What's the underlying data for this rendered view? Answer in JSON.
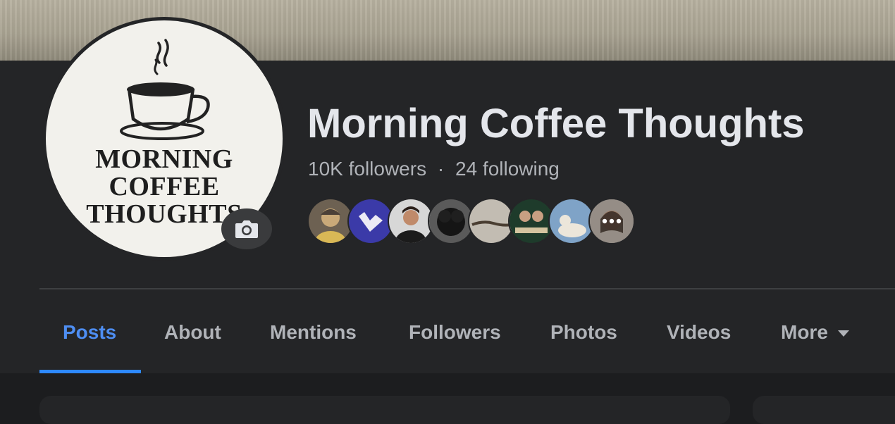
{
  "page": {
    "name": "Morning Coffee Thoughts",
    "logo_lines": [
      "MORNING",
      "COFFEE",
      "THOUGHTS"
    ],
    "followers": "10K followers",
    "separator": "·",
    "following": "24 following"
  },
  "follower_avatars": [
    {
      "name": "follower-avatar-1",
      "colors": [
        "#8a7a66",
        "#c9a979"
      ]
    },
    {
      "name": "follower-avatar-2",
      "colors": [
        "#3b3aa8",
        "#e8e8f0"
      ]
    },
    {
      "name": "follower-avatar-3",
      "colors": [
        "#d9d9d9",
        "#3a2c25"
      ]
    },
    {
      "name": "follower-avatar-4",
      "colors": [
        "#5a5a5a",
        "#151515"
      ]
    },
    {
      "name": "follower-avatar-5",
      "colors": [
        "#c2bcb2",
        "#5a4c3e"
      ]
    },
    {
      "name": "follower-avatar-6",
      "colors": [
        "#1e3b2b",
        "#d4c4a0"
      ]
    },
    {
      "name": "follower-avatar-7",
      "colors": [
        "#7fa3c7",
        "#e9e3d6"
      ]
    },
    {
      "name": "follower-avatar-8",
      "colors": [
        "#cfc4b8",
        "#5b4637"
      ]
    }
  ],
  "more_followers_icon": "more-dots-icon",
  "tabs": [
    {
      "label": "Posts",
      "active": true
    },
    {
      "label": "About"
    },
    {
      "label": "Mentions"
    },
    {
      "label": "Followers"
    },
    {
      "label": "Photos"
    },
    {
      "label": "Videos"
    },
    {
      "label": "More"
    }
  ],
  "colors": {
    "accent": "#2d88ff",
    "panel": "#242527",
    "text_primary": "#e4e6eb",
    "text_secondary": "#b0b3b8"
  }
}
